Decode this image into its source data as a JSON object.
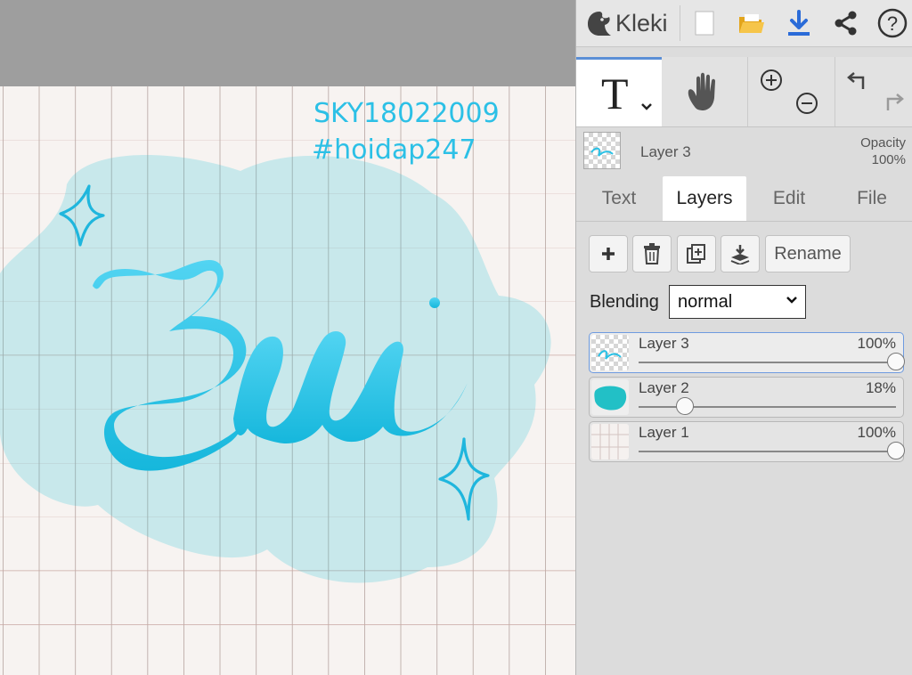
{
  "app": {
    "name": "Kleki"
  },
  "topbar": {
    "icons": [
      "new-image-icon",
      "open-folder-icon",
      "download-icon",
      "share-icon",
      "help-icon"
    ],
    "help_glyph": "?"
  },
  "tools": {
    "text_tool_glyph": "T"
  },
  "canvas": {
    "watermark_line1": "SKY18022009",
    "watermark_line2": "#hoidap247"
  },
  "current_layer": {
    "name": "Layer 3",
    "opacity_label": "Opacity",
    "opacity_value": "100%"
  },
  "tabs": [
    {
      "label": "Text",
      "active": false
    },
    {
      "label": "Layers",
      "active": true
    },
    {
      "label": "Edit",
      "active": false
    },
    {
      "label": "File",
      "active": false
    }
  ],
  "layer_controls": {
    "rename_label": "Rename"
  },
  "blending": {
    "label": "Blending",
    "value": "normal"
  },
  "layers": [
    {
      "name": "Layer 3",
      "opacity": "100%",
      "opacity_value": 1.0,
      "selected": true
    },
    {
      "name": "Layer 2",
      "opacity": "18%",
      "opacity_value": 0.18,
      "selected": false
    },
    {
      "name": "Layer 1",
      "opacity": "100%",
      "opacity_value": 1.0,
      "selected": false
    }
  ],
  "colors": {
    "accent": "#5b8fd6",
    "ink": "#29c1e6",
    "blob": "#cdeef2"
  }
}
